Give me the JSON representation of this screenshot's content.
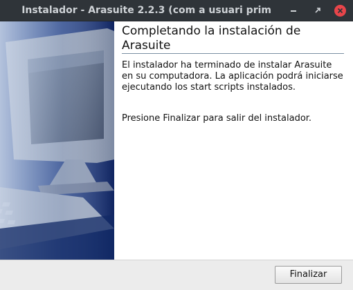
{
  "window": {
    "title": "Instalador - Arasuite 2.2.3 (com a usuari prim"
  },
  "content": {
    "heading": "Completando la instalación de Arasuite",
    "paragraph_1": "El instalador ha terminado de instalar Arasuite en su computadora. La aplicación podrá iniciarse ejecutando los start scripts instalados.",
    "paragraph_2": "Presione Finalizar para salir del instalador."
  },
  "footer": {
    "finish_label": "Finalizar"
  },
  "icons": {
    "minimize": "minimize-icon",
    "maximize": "maximize-icon",
    "close": "close-icon",
    "banner": "computer-monitor-keyboard-illustration"
  },
  "colors": {
    "titlebar": "#2f3439",
    "close_button": "#e8454a",
    "banner_blue": "#16306a"
  }
}
